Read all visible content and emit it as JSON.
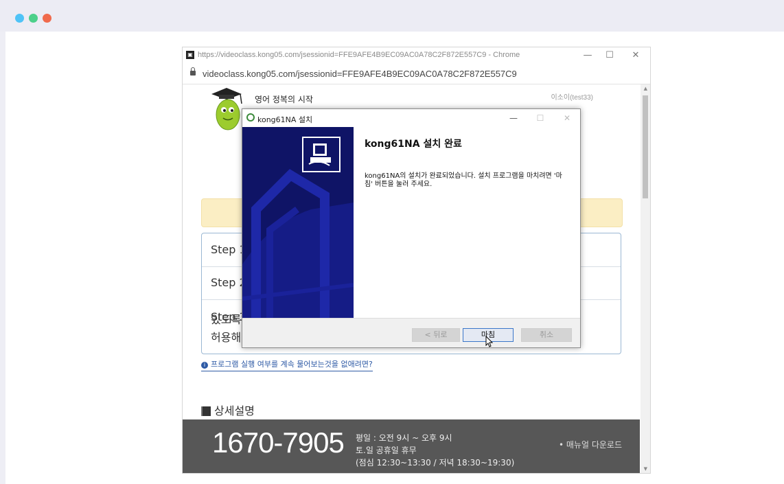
{
  "chrome": {
    "title": "https://videoclass.kong05.com/jsessionid=FFE9AFE4B9EC09AC0A78C2F872E557C9 - Chrome",
    "url": "videoclass.kong05.com/jsessionid=FFE9AFE4B9EC09AC0A78C2F872E557C9",
    "minimize": "—",
    "maximize": "☐",
    "close": "✕"
  },
  "page": {
    "brand_line1": "영어 정복의 시작",
    "user": "이소이(test33)",
    "steps": [
      {
        "label": "Step 1"
      },
      {
        "label": "Step 2"
      },
      {
        "label": "Step 3",
        "right_text": "있도록",
        "line2": "허용해"
      }
    ],
    "help_link": "프로그램 실행 여부를 계속 물어보는것을 없애려면?",
    "help_icon": "i",
    "detail_heading": "상세설명",
    "footer": {
      "phone": "1670-7905",
      "hours_weekday": "평일 : 오전 9시 ~ 오후 9시",
      "hours_holiday": "토.일 공휴일 휴무",
      "hours_break": "(점심 12:30~13:30 / 저녁 18:30~19:30)",
      "manual": "• 매뉴얼 다운로드"
    }
  },
  "dialog": {
    "title": "kong61NA 설치",
    "minimize": "—",
    "maximize": "☐",
    "close": "✕",
    "heading": "kong61NA 설치 완료",
    "body": "kong61NA의 설치가 완료되었습니다. 설치 프로그램을 마치려면 '마침' 버튼을 눌러 주세요.",
    "back_label": "< 뒤로",
    "finish_label": "마침",
    "cancel_label": "취소"
  },
  "colors": {
    "dialog_banner": "#0f1466",
    "footer_bg": "#575757",
    "steps_border": "#9ab7d3",
    "notice_bg": "#fbeec4"
  }
}
